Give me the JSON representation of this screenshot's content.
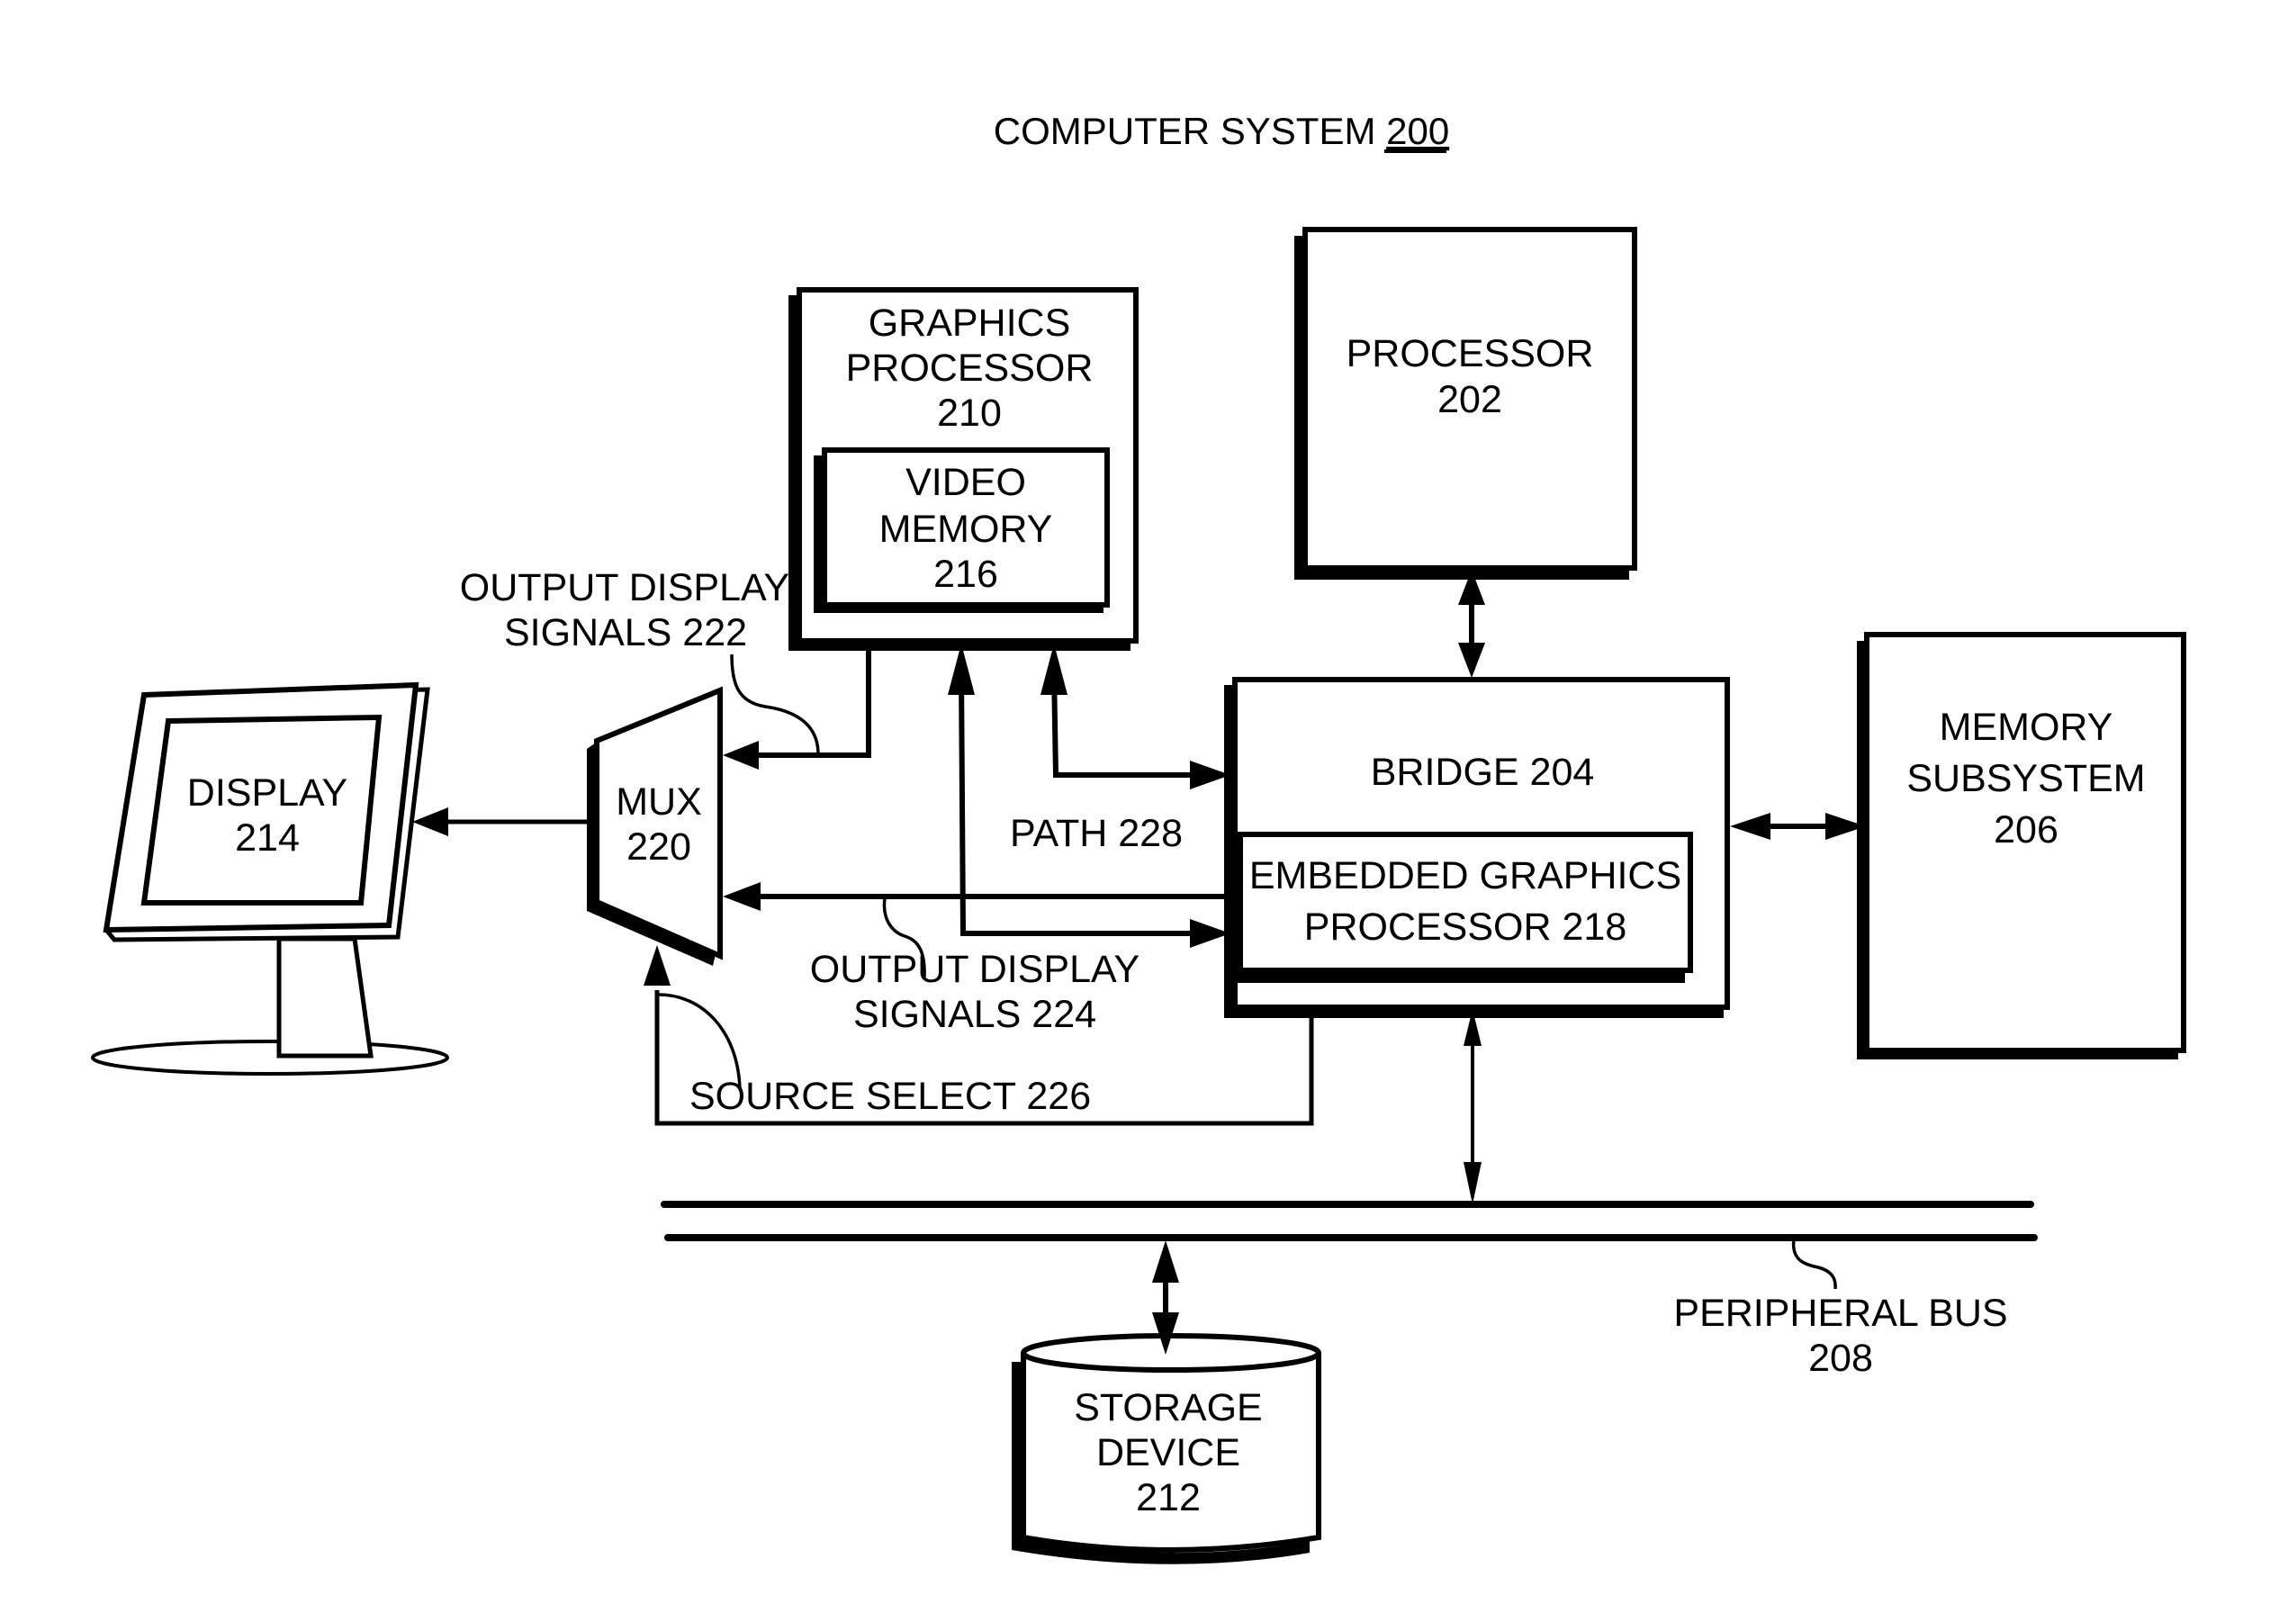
{
  "title": {
    "text": "COMPUTER SYSTEM ",
    "number": "200"
  },
  "components": {
    "graphics_processor": {
      "lines": [
        "GRAPHICS",
        "PROCESSOR",
        "210"
      ]
    },
    "video_memory": {
      "lines": [
        "VIDEO",
        "MEMORY",
        "216"
      ]
    },
    "processor": {
      "lines": [
        "PROCESSOR",
        "202"
      ]
    },
    "bridge": {
      "lines": [
        "BRIDGE 204"
      ]
    },
    "embedded_graphics": {
      "lines": [
        "EMBEDDED GRAPHICS",
        "PROCESSOR 218"
      ]
    },
    "memory_subsystem": {
      "lines": [
        "MEMORY",
        "SUBSYSTEM",
        "206"
      ]
    },
    "display": {
      "lines": [
        "DISPLAY",
        "214"
      ]
    },
    "mux": {
      "lines": [
        "MUX",
        "220"
      ]
    },
    "storage_device": {
      "lines": [
        "STORAGE",
        "DEVICE",
        "212"
      ]
    }
  },
  "signals": {
    "output_display_222": {
      "lines": [
        "OUTPUT DISPLAY",
        "SIGNALS 222"
      ]
    },
    "output_display_224": {
      "lines": [
        "OUTPUT DISPLAY",
        "SIGNALS 224"
      ]
    },
    "path_228": {
      "text": "PATH 228"
    },
    "source_select_226": {
      "text": "SOURCE SELECT 226"
    },
    "peripheral_bus": {
      "lines": [
        "PERIPHERAL BUS",
        "208"
      ]
    }
  }
}
